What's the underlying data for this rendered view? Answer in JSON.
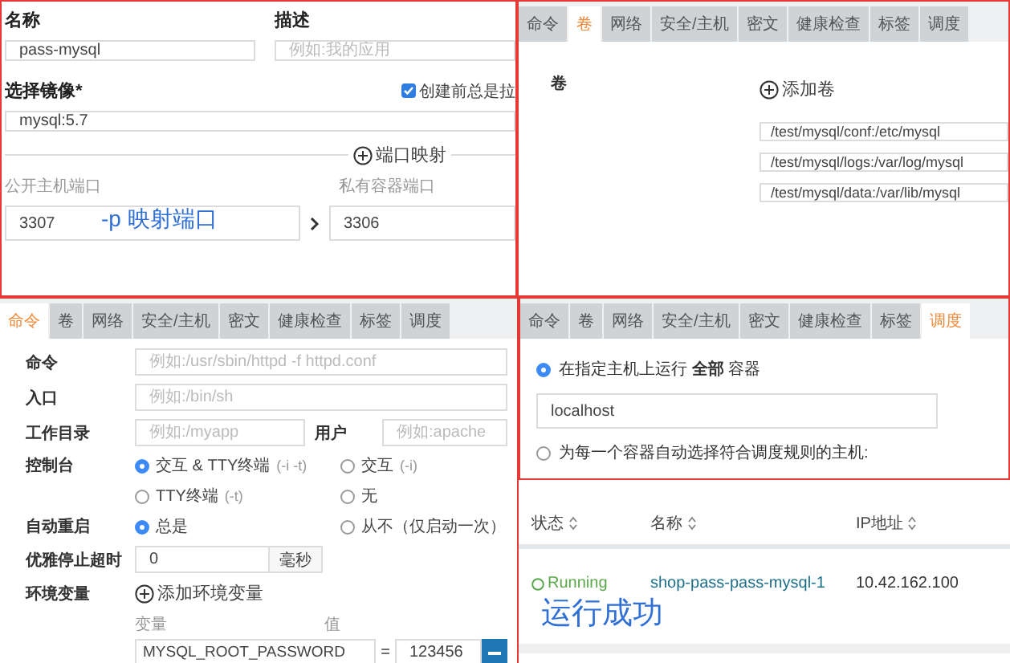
{
  "image_form": {
    "name_label": "名称",
    "name_value": "pass-mysql",
    "description_label": "描述",
    "description_placeholder": "例如:我的应用",
    "image_label": "选择镜像*",
    "always_pull": {
      "label": "创建前总是拉",
      "checked": true
    },
    "image_value": "mysql:5.7",
    "port_mapping_button": "端口映射",
    "public_port_label": "公开主机端口",
    "private_port_label": "私有容器端口",
    "public_port": "3307",
    "private_port": "3306",
    "annotation": "-p  映射端口"
  },
  "volumes_panel": {
    "tabs": [
      {
        "label": "命令",
        "selected": false
      },
      {
        "label": "卷",
        "selected": true
      },
      {
        "label": "网络",
        "selected": false
      },
      {
        "label": "安全/主机",
        "selected": false
      },
      {
        "label": "密文",
        "selected": false
      },
      {
        "label": "健康检查",
        "selected": false
      },
      {
        "label": "标签",
        "selected": false
      },
      {
        "label": "调度",
        "selected": false
      }
    ],
    "section_label": "卷",
    "add_button": "添加卷",
    "volumes": [
      "/test/mysql/conf:/etc/mysql",
      "/test/mysql/logs:/var/log/mysql",
      "/test/mysql/data:/var/lib/mysql"
    ]
  },
  "command_panel": {
    "tabs": [
      {
        "label": "命令",
        "selected": true
      },
      {
        "label": "卷",
        "selected": false
      },
      {
        "label": "网络",
        "selected": false
      },
      {
        "label": "安全/主机",
        "selected": false
      },
      {
        "label": "密文",
        "selected": false
      },
      {
        "label": "健康检查",
        "selected": false
      },
      {
        "label": "标签",
        "selected": false
      },
      {
        "label": "调度",
        "selected": false
      }
    ],
    "command": {
      "label": "命令",
      "placeholder": "例如:/usr/sbin/httpd -f httpd.conf"
    },
    "entrypoint": {
      "label": "入口",
      "placeholder": "例如:/bin/sh"
    },
    "workdir": {
      "label": "工作目录",
      "placeholder": "例如:/myapp"
    },
    "user": {
      "label": "用户",
      "placeholder": "例如:apache"
    },
    "console": {
      "label": "控制台",
      "options": [
        {
          "label": "交互 & TTY终端",
          "hint": "(-i -t)",
          "selected": true
        },
        {
          "label": "交互",
          "hint": "(-i)",
          "selected": false
        },
        {
          "label": "TTY终端",
          "hint": "(-t)",
          "selected": false
        },
        {
          "label": "无",
          "selected": false
        }
      ]
    },
    "restart": {
      "label": "自动重启",
      "options": [
        {
          "label": "总是",
          "selected": true
        },
        {
          "label": "从不（仅启动一次）",
          "selected": false
        }
      ]
    },
    "stop_timeout": {
      "label": "优雅停止超时",
      "value": "0",
      "unit": "毫秒"
    },
    "env": {
      "label": "环境变量",
      "add_button": "添加环境变量",
      "key_label": "变量",
      "value_label": "值",
      "rows": [
        {
          "key": "MYSQL_ROOT_PASSWORD",
          "separator": "=",
          "value": "123456"
        }
      ]
    }
  },
  "schedule_panel": {
    "tabs": [
      {
        "label": "命令",
        "selected": false
      },
      {
        "label": "卷",
        "selected": false
      },
      {
        "label": "网络",
        "selected": false
      },
      {
        "label": "安全/主机",
        "selected": false
      },
      {
        "label": "密文",
        "selected": false
      },
      {
        "label": "健康检查",
        "selected": false
      },
      {
        "label": "标签",
        "selected": false
      },
      {
        "label": "调度",
        "selected": true
      }
    ],
    "options": [
      {
        "label": "在指定主机上运行 **全部** 容器",
        "selected": true
      },
      {
        "label": "为每一个容器自动选择符合调度规则的主机:",
        "selected": false
      }
    ],
    "host_value": "localhost"
  },
  "containers_table": {
    "columns": [
      "状态",
      "名称",
      "IP地址"
    ],
    "rows": [
      {
        "status": "Running",
        "name": "shop-pass-pass-mysql-1",
        "ip": "10.42.162.100"
      }
    ],
    "annotation": "运行成功"
  }
}
